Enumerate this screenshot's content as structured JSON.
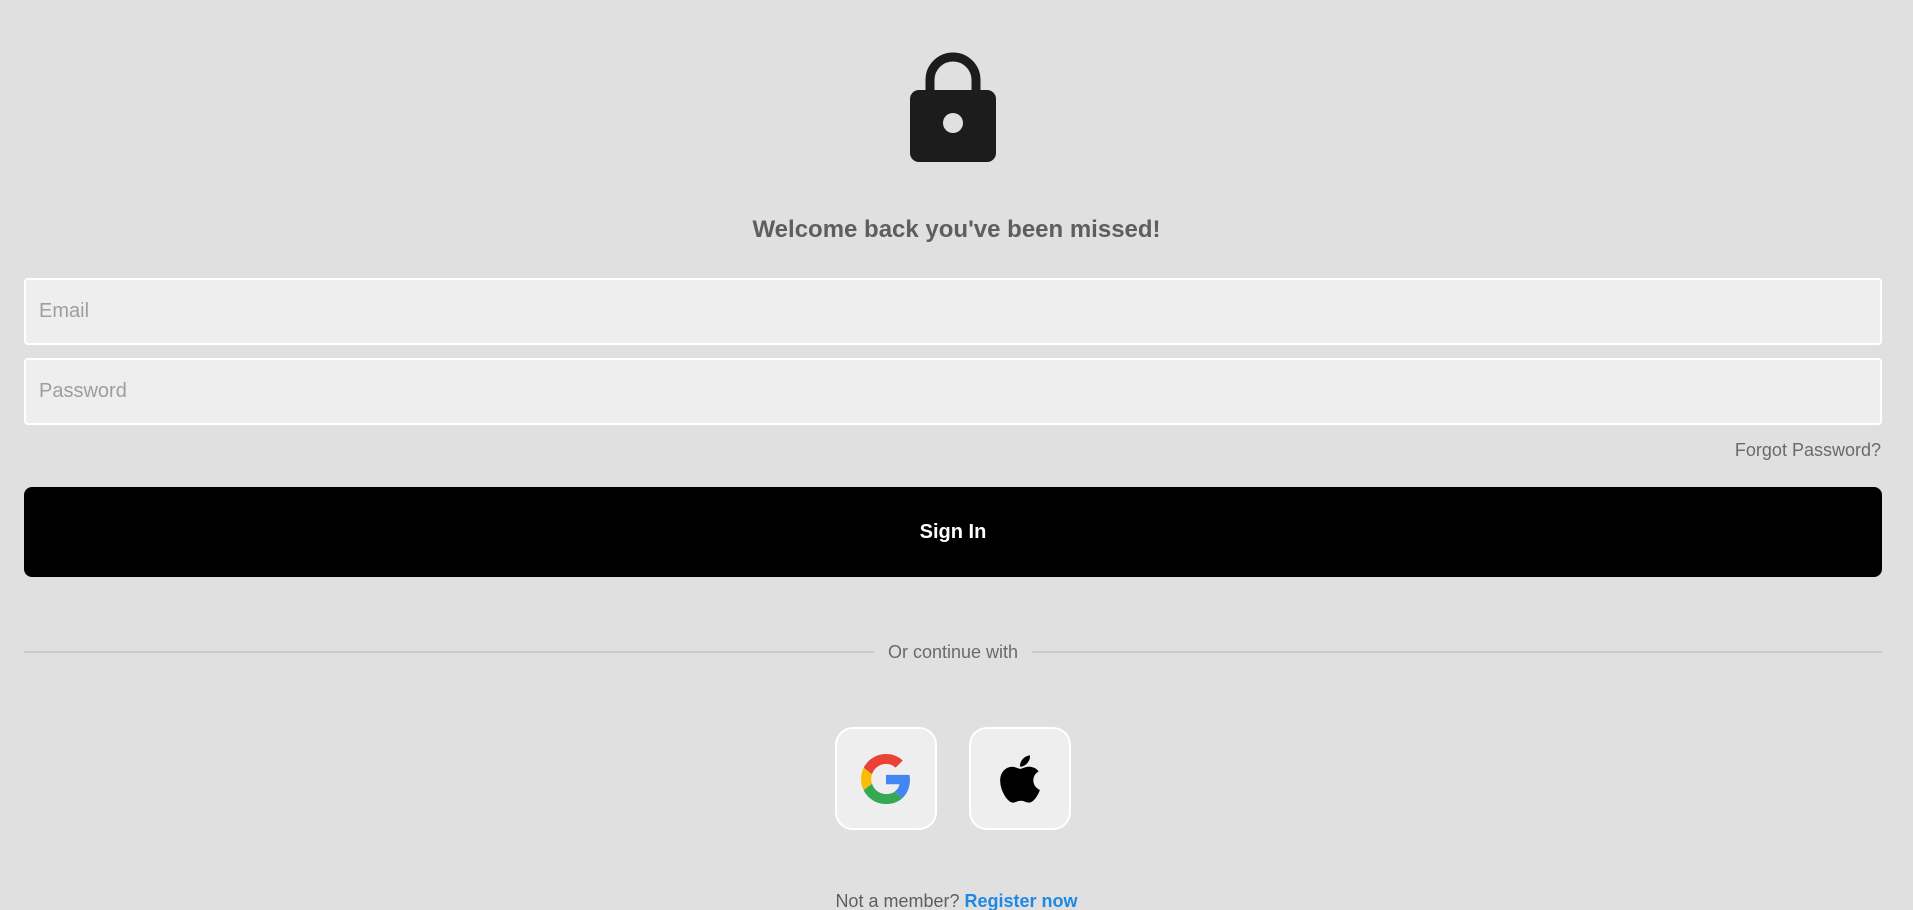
{
  "icons": {
    "header": "lock-icon",
    "google": "google-icon",
    "apple": "apple-icon"
  },
  "heading": "Welcome back you've been missed!",
  "form": {
    "email_placeholder": "Email",
    "password_placeholder": "Password",
    "forgot_password": "Forgot Password?",
    "sign_in_label": "Sign In"
  },
  "divider_text": "Or continue with",
  "footer": {
    "prompt": "Not a member?",
    "register_link": "Register now"
  },
  "colors": {
    "background": "#e0e0e0",
    "field_background": "#eeeeee",
    "primary_button": "#000000",
    "link": "#1e88e5",
    "heading": "#5e5e5e"
  }
}
